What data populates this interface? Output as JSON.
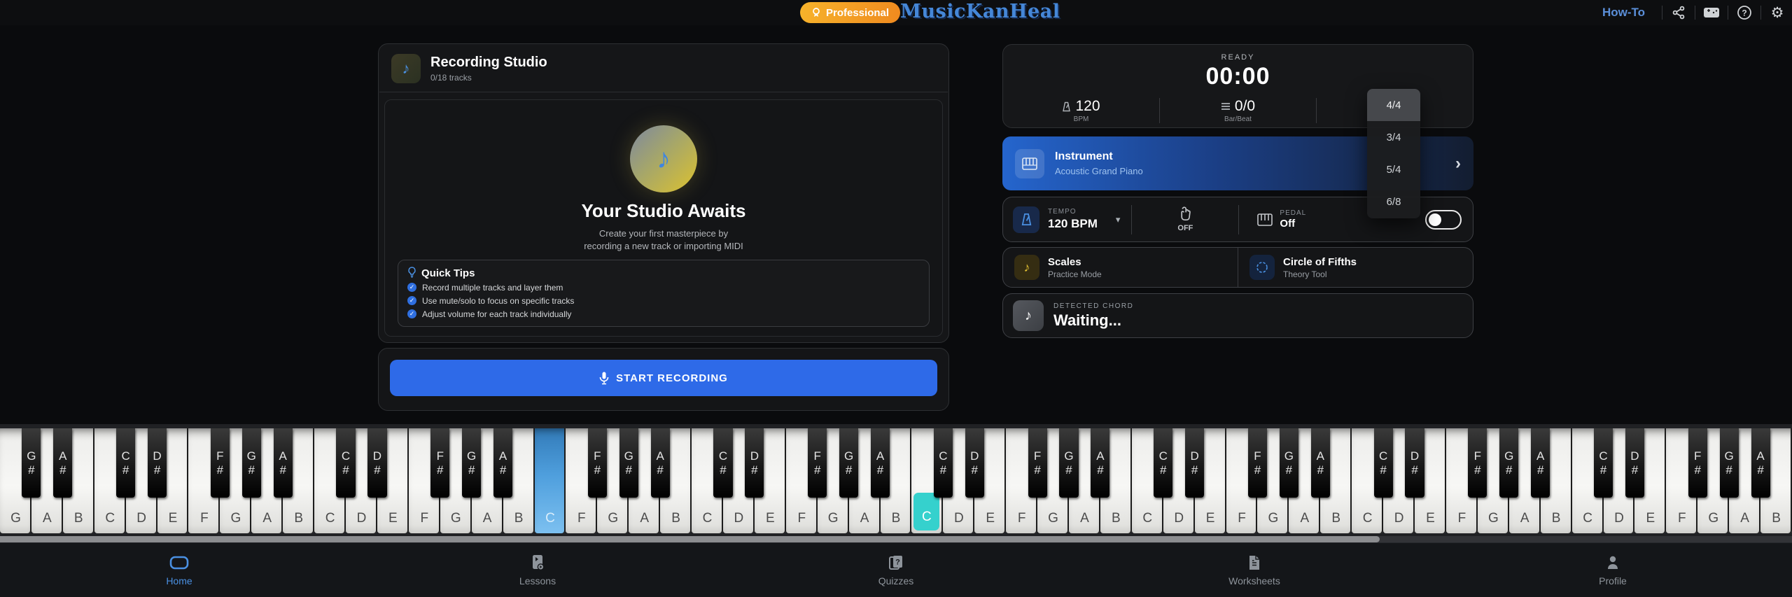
{
  "top_bar": {
    "badge": "Professional",
    "logo": "MusicKanHeal",
    "how_to": "How-To",
    "icons": [
      "share-icon",
      "midi-device-icon",
      "help-icon",
      "settings-icon"
    ]
  },
  "recording_studio": {
    "title": "Recording Studio",
    "subtitle": "0/18 tracks",
    "empty_state": {
      "heading": "Your Studio Awaits",
      "description_line1": "Create your first masterpiece by",
      "description_line2": "recording a new track or importing MIDI"
    },
    "quick_tips": {
      "title": "Quick Tips",
      "items": [
        "Record multiple tracks and layer them",
        "Use mute/solo to focus on specific tracks",
        "Adjust volume for each track individually"
      ]
    },
    "record_button": "START RECORDING"
  },
  "transport": {
    "status": "READY",
    "time": "00:00",
    "bpm_value": "120",
    "bpm_label": "BPM",
    "bar_beat_value": "0/0",
    "bar_beat_label": "Bar/Beat",
    "time_signature": "4/4",
    "time_signature_options": [
      "4/4",
      "3/4",
      "5/4",
      "6/8"
    ]
  },
  "instrument": {
    "label": "Instrument",
    "value": "Acoustic Grand Piano"
  },
  "tempo": {
    "label": "TEMPO",
    "value": "120 BPM",
    "metronome_state": "OFF",
    "pedal_label": "PEDAL",
    "pedal_state": "Off",
    "pedal_toggle_on": false
  },
  "tools": {
    "scales": {
      "title": "Scales",
      "subtitle": "Practice Mode"
    },
    "circle_of_fifths": {
      "title": "Circle of Fifths",
      "subtitle": "Theory Tool"
    }
  },
  "detected_chord": {
    "label": "DETECTED CHORD",
    "value": "Waiting..."
  },
  "keyboard": {
    "scroll_thumb_percent": 77,
    "keys": [
      {
        "label": "G",
        "sharp": true
      },
      {
        "label": "A",
        "sharp": true
      },
      {
        "label": "B",
        "sharp": false
      },
      {
        "label": "C",
        "sharp": true
      },
      {
        "label": "D",
        "sharp": true
      },
      {
        "label": "E",
        "sharp": false
      },
      {
        "label": "F",
        "sharp": true
      },
      {
        "label": "G",
        "sharp": true
      },
      {
        "label": "A",
        "sharp": true
      },
      {
        "label": "B",
        "sharp": false
      },
      {
        "label": "C",
        "sharp": true
      },
      {
        "label": "D",
        "sharp": true
      },
      {
        "label": "E",
        "sharp": false
      },
      {
        "label": "F",
        "sharp": true
      },
      {
        "label": "G",
        "sharp": true
      },
      {
        "label": "A",
        "sharp": true
      },
      {
        "label": "B",
        "sharp": false
      },
      {
        "label": "C",
        "sharp": false,
        "highlight": "blue"
      },
      {
        "label": "F",
        "sharp": true
      },
      {
        "label": "G",
        "sharp": true
      },
      {
        "label": "A",
        "sharp": true
      },
      {
        "label": "B",
        "sharp": false
      },
      {
        "label": "C",
        "sharp": true
      },
      {
        "label": "D",
        "sharp": true
      },
      {
        "label": "E",
        "sharp": false
      },
      {
        "label": "F",
        "sharp": true
      },
      {
        "label": "G",
        "sharp": true
      },
      {
        "label": "A",
        "sharp": true
      },
      {
        "label": "B",
        "sharp": false
      },
      {
        "label": "C",
        "sharp": true,
        "highlight": "cyan"
      },
      {
        "label": "D",
        "sharp": true
      },
      {
        "label": "E",
        "sharp": false
      },
      {
        "label": "F",
        "sharp": true
      },
      {
        "label": "G",
        "sharp": true
      },
      {
        "label": "A",
        "sharp": true
      },
      {
        "label": "B",
        "sharp": false
      },
      {
        "label": "C",
        "sharp": true
      },
      {
        "label": "D",
        "sharp": true
      },
      {
        "label": "E",
        "sharp": false
      },
      {
        "label": "F",
        "sharp": true
      },
      {
        "label": "G",
        "sharp": true
      },
      {
        "label": "A",
        "sharp": true
      },
      {
        "label": "B",
        "sharp": false
      },
      {
        "label": "C",
        "sharp": true
      },
      {
        "label": "D",
        "sharp": true
      },
      {
        "label": "E",
        "sharp": false
      },
      {
        "label": "F",
        "sharp": true
      },
      {
        "label": "G",
        "sharp": true
      },
      {
        "label": "A",
        "sharp": true
      },
      {
        "label": "B",
        "sharp": false
      },
      {
        "label": "C",
        "sharp": true
      },
      {
        "label": "D",
        "sharp": true
      },
      {
        "label": "E",
        "sharp": false
      },
      {
        "label": "F",
        "sharp": true
      },
      {
        "label": "G",
        "sharp": true
      },
      {
        "label": "A",
        "sharp": true
      },
      {
        "label": "B",
        "sharp": false
      }
    ]
  },
  "bottom_nav": {
    "items": [
      {
        "label": "Home",
        "icon": "home-icon",
        "active": true
      },
      {
        "label": "Lessons",
        "icon": "lessons-icon",
        "active": false
      },
      {
        "label": "Quizzes",
        "icon": "quizzes-icon",
        "active": false
      },
      {
        "label": "Worksheets",
        "icon": "worksheets-icon",
        "active": false
      },
      {
        "label": "Profile",
        "icon": "profile-icon",
        "active": false
      }
    ]
  },
  "colors": {
    "accent_blue": "#2e6ae8",
    "key_highlight_blue": "#4f9fdd",
    "key_highlight_cyan": "#35d1cd",
    "badge_gradient_start": "#f7b32b",
    "badge_gradient_end": "#ef8a1f",
    "logo_blue": "#4587d8"
  }
}
